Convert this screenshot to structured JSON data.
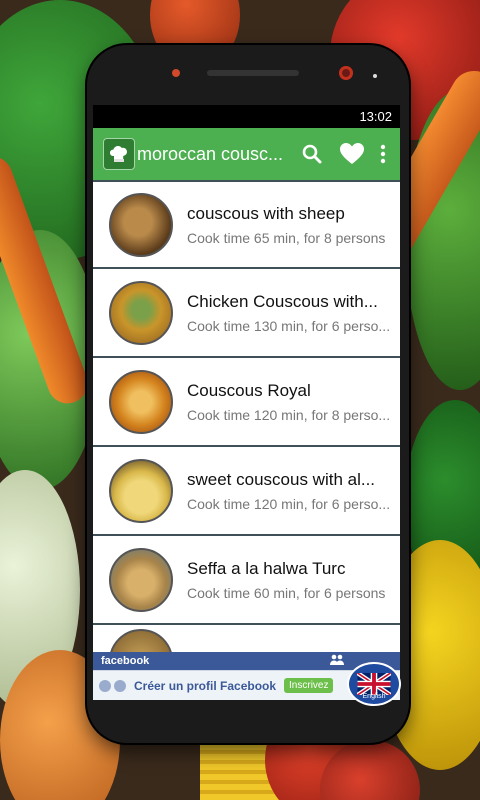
{
  "statusbar": {
    "time": "13:02"
  },
  "appbar": {
    "title": "moroccan cousc...",
    "search_icon": "search-icon",
    "favorite_icon": "heart-icon",
    "more_icon": "more-vert-icon",
    "accent": "#4caf50"
  },
  "recipes": [
    {
      "title": "couscous with sheep",
      "subtitle": "Cook time 65 min, for 8 persons",
      "thumb_color": "#8a5a2a"
    },
    {
      "title": "Chicken Couscous with...",
      "subtitle": "Cook time 130 min, for 6 perso...",
      "thumb_color": "#c98a2a"
    },
    {
      "title": "Couscous Royal",
      "subtitle": "Cook time 120 min, for 8 perso...",
      "thumb_color": "#d4901e"
    },
    {
      "title": "sweet couscous with al...",
      "subtitle": "Cook time 120 min, for 6 perso...",
      "thumb_color": "#e2c45a"
    },
    {
      "title": "Seffa a la halwa Turc",
      "subtitle": "Cook time 60 min, for 6 persons",
      "thumb_color": "#c8a46a"
    }
  ],
  "ad": {
    "brand": "facebook",
    "text": "Créer un profil Facebook",
    "cta": "Inscrivez"
  },
  "badge": {
    "label": "English"
  }
}
